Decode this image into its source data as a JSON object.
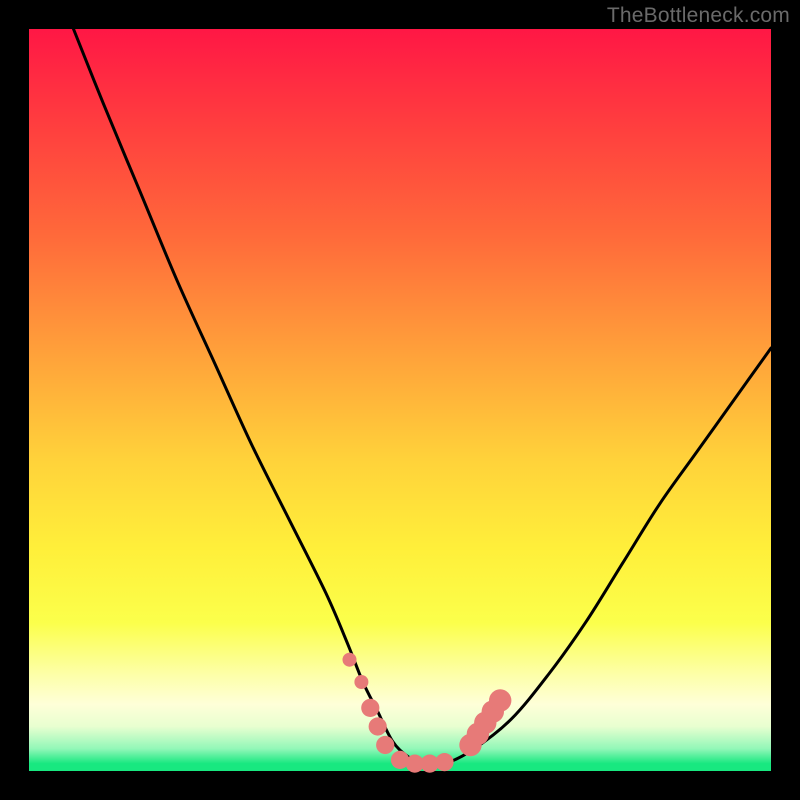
{
  "watermark": "TheBottleneck.com",
  "colors": {
    "frame": "#000000",
    "curve": "#000000",
    "marker_fill": "#e77a78",
    "marker_stroke": "#d86b69"
  },
  "chart_data": {
    "type": "line",
    "title": "",
    "xlabel": "",
    "ylabel": "",
    "xlim": [
      0,
      100
    ],
    "ylim": [
      0,
      100
    ],
    "series": [
      {
        "name": "bottleneck-curve",
        "x": [
          6,
          10,
          15,
          20,
          25,
          30,
          35,
          40,
          43,
          45,
          47,
          49,
          51,
          53,
          56,
          60,
          65,
          70,
          75,
          80,
          85,
          90,
          95,
          100
        ],
        "y": [
          100,
          90,
          78,
          66,
          55,
          44,
          34,
          24,
          17,
          12,
          8,
          4,
          2,
          1,
          1,
          3,
          7,
          13,
          20,
          28,
          36,
          43,
          50,
          57
        ]
      }
    ],
    "markers": [
      {
        "x": 43.2,
        "y": 15.0,
        "r": 1.0
      },
      {
        "x": 44.8,
        "y": 12.0,
        "r": 1.0
      },
      {
        "x": 46.0,
        "y": 8.5,
        "r": 1.3
      },
      {
        "x": 47.0,
        "y": 6.0,
        "r": 1.3
      },
      {
        "x": 48.0,
        "y": 3.5,
        "r": 1.3
      },
      {
        "x": 50.0,
        "y": 1.5,
        "r": 1.3
      },
      {
        "x": 52.0,
        "y": 1.0,
        "r": 1.3
      },
      {
        "x": 54.0,
        "y": 1.0,
        "r": 1.3
      },
      {
        "x": 56.0,
        "y": 1.2,
        "r": 1.3
      },
      {
        "x": 59.5,
        "y": 3.5,
        "r": 1.6
      },
      {
        "x": 60.5,
        "y": 5.0,
        "r": 1.6
      },
      {
        "x": 61.5,
        "y": 6.5,
        "r": 1.6
      },
      {
        "x": 62.5,
        "y": 8.0,
        "r": 1.6
      },
      {
        "x": 63.5,
        "y": 9.5,
        "r": 1.6
      }
    ]
  }
}
